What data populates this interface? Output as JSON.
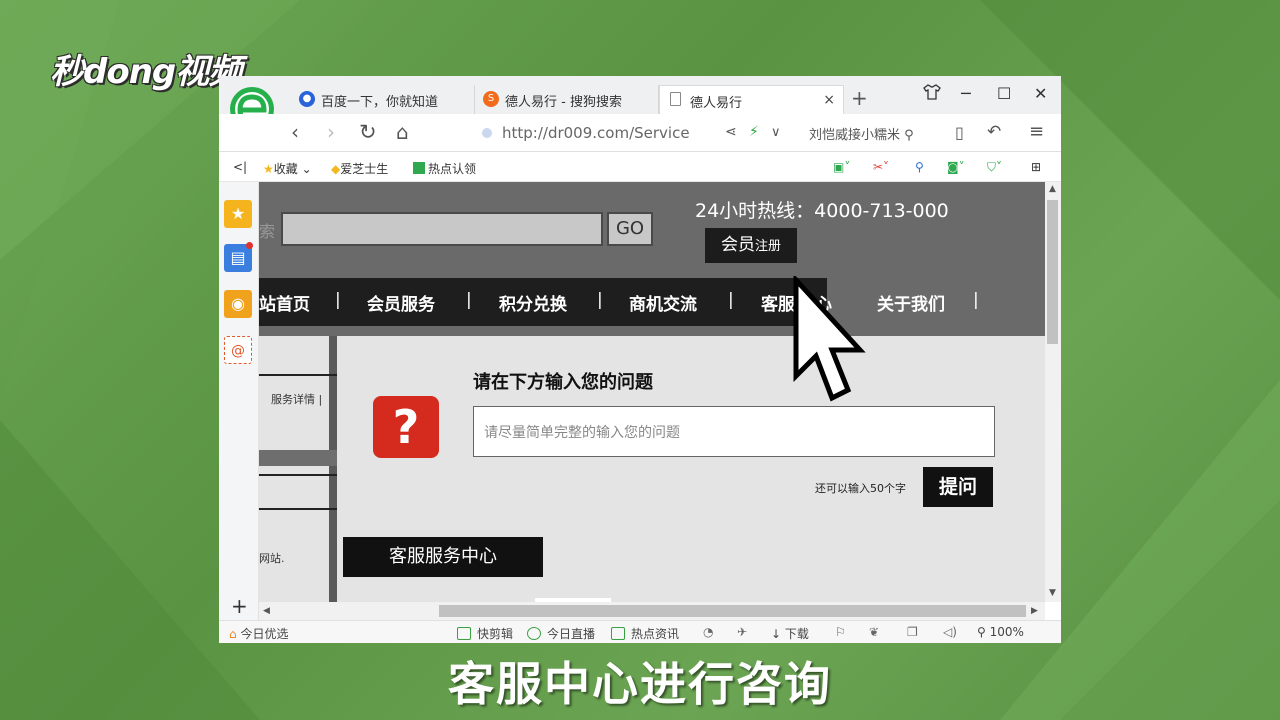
{
  "video": {
    "logo": "秒dong视频",
    "subtitle": "客服中心进行咨询"
  },
  "browser": {
    "tabs": [
      {
        "label": "百度一下，你就知道",
        "icon": "baidu-paw-icon"
      },
      {
        "label": "德人易行 - 搜狗搜索",
        "icon": "sogou-icon"
      },
      {
        "label": "德人易行",
        "icon": "page-icon",
        "active": true
      }
    ],
    "url": "http://dr009.com/Service",
    "search_hint": "刘恺威接小糯米",
    "bookmarks": [
      "收藏",
      "爱芝士生",
      "热点认领"
    ],
    "status": {
      "left": "今日优选",
      "items": [
        "快剪辑",
        "今日直播",
        "热点资讯",
        "下载"
      ],
      "zoom": "100%"
    }
  },
  "site": {
    "search_stub": "索",
    "go_label": "GO",
    "hotline": "24小时热线：4000-713-000",
    "member_label": "会员",
    "register_label": "注册",
    "menu": [
      "站首页",
      "会员服务",
      "积分兑换",
      "商机交流",
      "客服",
      "心",
      "关于我们"
    ],
    "left_detail": "服务详情 |",
    "left_site": "网站.",
    "question_title": "请在下方输入您的问题",
    "question_placeholder": "请尽量简单完整的输入您的问题",
    "remaining_text": "还可以输入50个字",
    "submit_label": "提问",
    "cs_center_label": "客服服务中心"
  },
  "colors": {
    "background_green": "#5f9a48",
    "question_icon_red": "#d52b1e",
    "header_gray": "#6a6a6a",
    "menu_black": "#1e1e1e"
  }
}
